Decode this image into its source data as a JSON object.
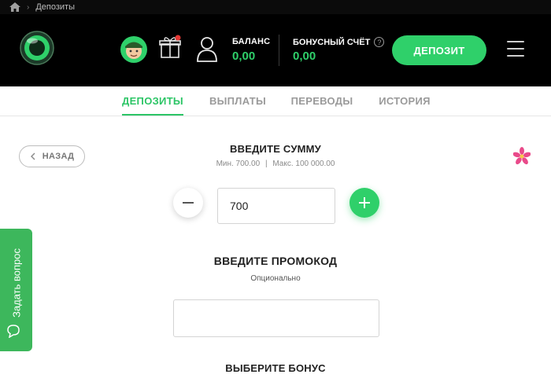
{
  "breadcrumb": {
    "home_icon": "home-icon",
    "items": [
      "Депозиты"
    ]
  },
  "header": {
    "logo_icon": "casino-logo",
    "avatar_icon": "user-avatar",
    "gift_icon": "gift-icon",
    "profile_icon": "profile-icon",
    "balance_label": "БАЛАНС",
    "balance_value": "0,00",
    "bonus_label": "БОНУСНЫЙ СЧЁТ",
    "bonus_help": "?",
    "bonus_value": "0,00",
    "deposit_button": "ДЕПОЗИТ",
    "menu_icon": "hamburger-menu-icon"
  },
  "tabs": [
    {
      "label": "ДЕПОЗИТЫ",
      "active": true
    },
    {
      "label": "ВЫПЛАТЫ",
      "active": false
    },
    {
      "label": "ПЕРЕВОДЫ",
      "active": false
    },
    {
      "label": "ИСТОРИЯ",
      "active": false
    }
  ],
  "back_button": "НАЗАД",
  "amount": {
    "title": "ВВЕДИТЕ СУММУ",
    "min": "Мин. 700.00",
    "max": "Макс. 100 000.00",
    "value": "700"
  },
  "promo": {
    "title": "ВВЕДИТЕ ПРОМОКОД",
    "subtitle": "Опционально",
    "value": ""
  },
  "bonus": {
    "title": "ВЫБЕРИТЕ БОНУС"
  },
  "side_button": {
    "label": "Задать вопрос"
  },
  "colors": {
    "accent": "#2fd06a",
    "header_bg": "#000000",
    "side_button": "#3db75c"
  }
}
